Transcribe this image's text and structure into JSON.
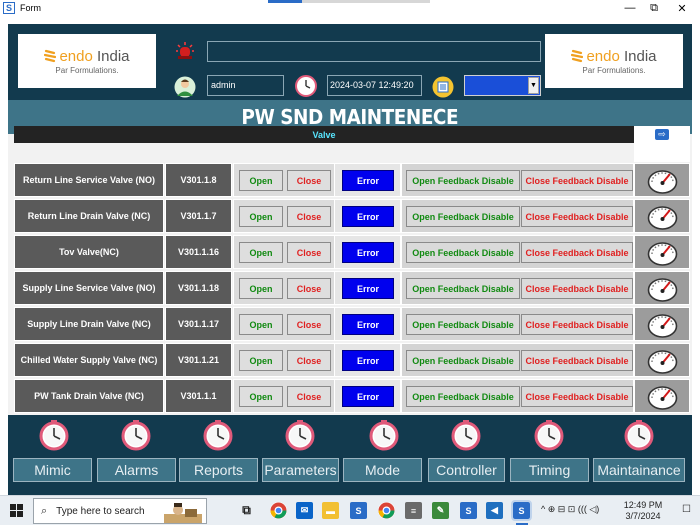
{
  "window": {
    "title": "Form",
    "minimize": "—",
    "restore": "⧉",
    "close": "✕"
  },
  "header": {
    "logo_left": {
      "brand": "endo",
      "brand_suffix": "India",
      "tagline": "Par Formulations."
    },
    "logo_right": {
      "brand": "endo",
      "brand_suffix": "India",
      "tagline": "Par Formulations."
    },
    "message": "",
    "user": "admin",
    "datetime": "2024-03-07 12:49:20",
    "combo_value": ""
  },
  "page_title": "PW SND MAINTENECE",
  "table": {
    "header": "Valve",
    "nav_glyph": "⇨",
    "labels": {
      "open": "Open",
      "close": "Close",
      "error": "Error",
      "open_fb": "Open Feedback Disable",
      "close_fb": "Close Feedback Disable"
    },
    "rows": [
      {
        "name": "Return Line Service Valve (NO)",
        "tag": "V301.1.8"
      },
      {
        "name": "Return Line Drain Valve (NC)",
        "tag": "V301.1.7"
      },
      {
        "name": "Tov Valve(NC)",
        "tag": "V301.1.16"
      },
      {
        "name": "Supply Line Service Valve (NO)",
        "tag": "V301.1.18"
      },
      {
        "name": "Supply Line Drain Valve (NC)",
        "tag": "V301.1.17"
      },
      {
        "name": "Chilled Water Supply Valve (NC)",
        "tag": "V301.1.21"
      },
      {
        "name": "PW Tank Drain Valve (NC)",
        "tag": "V301.1.1"
      }
    ]
  },
  "nav": [
    "Mimic",
    "Alarms",
    "Reports",
    "Parameters",
    "Mode",
    "Controller",
    "Timing",
    "Maintainance"
  ],
  "taskbar": {
    "search_placeholder": "Type here to search",
    "time": "12:49 PM",
    "date": "3/7/2024",
    "tray_symbols": "^ ⊕ ⊟ ⊡ ((( ◁)"
  },
  "colors": {
    "header_bg": "#123a4e",
    "band_bg": "#3e7488",
    "error_blue": "#0000ee",
    "open_green": "#118a11",
    "close_red": "#e02020",
    "cyan_text": "#58e6ff"
  }
}
